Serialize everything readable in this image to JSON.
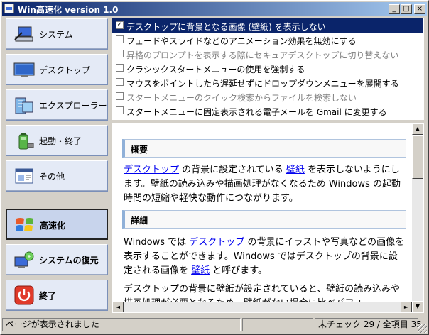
{
  "window": {
    "title": "Win高速化 version 1.0",
    "min_label": "_",
    "max_label": "□",
    "close_label": "×"
  },
  "nav": [
    {
      "label": "システム",
      "icon": "computer-icon",
      "active": false
    },
    {
      "label": "デスクトップ",
      "icon": "monitor-icon",
      "active": false
    },
    {
      "label": "エクスプローラー",
      "icon": "explorer-icon",
      "active": false
    },
    {
      "label": "起動・終了",
      "icon": "battery-icon",
      "active": false
    },
    {
      "label": "その他",
      "icon": "window-icon",
      "active": false
    },
    {
      "label": "高速化",
      "icon": "windows-flag-icon",
      "active": true
    },
    {
      "label": "システムの復元",
      "icon": "restore-icon",
      "active": false
    },
    {
      "label": "終了",
      "icon": "power-icon",
      "active": false
    }
  ],
  "checks": [
    {
      "text": "デスクトップに背景となる画像 (壁紙) を表示しない",
      "checked": true,
      "selected": true,
      "disabled": false
    },
    {
      "text": "フェードやスライドなどのアニメーション効果を無効にする",
      "checked": false,
      "selected": false,
      "disabled": false
    },
    {
      "text": "昇格のプロンプトを表示する際にセキュアデスクトップに切り替えない",
      "checked": false,
      "selected": false,
      "disabled": true
    },
    {
      "text": "クラシックスタートメニューの使用を強制する",
      "checked": false,
      "selected": false,
      "disabled": false
    },
    {
      "text": "マウスをポイントしたら遅延せずにドロップダウンメニューを展開する",
      "checked": false,
      "selected": false,
      "disabled": false
    },
    {
      "text": "スタートメニューのクイック検索からファイルを検索しない",
      "checked": false,
      "selected": false,
      "disabled": true
    },
    {
      "text": "スタートメニューに固定表示される電子メールを Gmail に変更する",
      "checked": false,
      "selected": false,
      "disabled": false
    }
  ],
  "content": {
    "overview_heading": "概要",
    "p1_link1": "デスクトップ",
    "p1_t1": " の背景に設定されている ",
    "p1_link2": "壁紙",
    "p1_t2": " を表示しないようにします。壁紙の読み込みや描画処理がなくなるため Windows の起動時間の短縮や軽快な動作につながります。",
    "detail_heading": "詳細",
    "p2_t1": "Windows では ",
    "p2_link1": "デスクトップ",
    "p2_t2": " の背景にイラストや写真などの画像を表示することができます。Windows ではデスクトップの背景に設定される画像を ",
    "p2_link2": "壁紙",
    "p2_t3": " と呼びます。",
    "p3": "デスクトップの背景に壁紙が設定されていると、壁紙の読み込みや描画処理が必要となるため、壁紙がない場合に比べパフォ"
  },
  "status": {
    "message": "ページが表示されました",
    "counts": "未チェック 29 / 全項目 35"
  }
}
